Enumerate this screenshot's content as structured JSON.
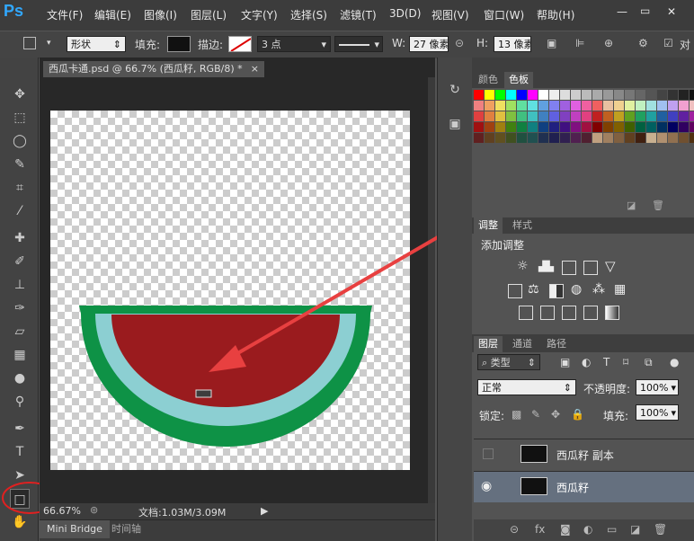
{
  "app": {
    "logo": "Ps"
  },
  "menu": [
    "文件(F)",
    "编辑(E)",
    "图像(I)",
    "图层(L)",
    "文字(Y)",
    "选择(S)",
    "滤镜(T)",
    "3D(D)",
    "视图(V)",
    "窗口(W)",
    "帮助(H)"
  ],
  "window_controls": {
    "minimize": "—",
    "maximize": "▭",
    "close": "✕"
  },
  "options": {
    "mode": "形状",
    "fill_label": "填充:",
    "stroke_label": "描边:",
    "stroke_width": "3 点",
    "w_label": "W:",
    "w_value": "27 像素",
    "h_label": "H:",
    "h_value": "13 像素",
    "align_label": "对"
  },
  "document": {
    "tab_title": "西瓜卡通.psd @ 66.7% (西瓜籽, RGB/8) *",
    "tab_close": "×",
    "zoom": "66.67%",
    "doc_info": "文档:1.03M/3.09M"
  },
  "bottom_tabs": [
    "Mini Bridge",
    "时间轴"
  ],
  "panels": {
    "color_tabs": [
      "颜色",
      "色板"
    ],
    "adjust_tabs": [
      "调整",
      "样式"
    ],
    "adjust_title": "添加调整",
    "layer_tabs": [
      "图层",
      "通道",
      "路径"
    ],
    "filter_kind": "类型",
    "blend_mode": "正常",
    "opacity_label": "不透明度:",
    "opacity_value": "100%",
    "lock_label": "锁定:",
    "fill_label": "填充:",
    "fill_value": "100%"
  },
  "layers": [
    {
      "name": "西瓜籽 副本",
      "visible": false
    },
    {
      "name": "西瓜籽",
      "visible": true,
      "selected": true
    }
  ],
  "colors": {
    "rind_outer": "#0e9246",
    "rind_inner": "#8ccfd2",
    "flesh": "#9a1b1e",
    "arrow": "#e84040",
    "highlight_circle": "#e02020"
  }
}
